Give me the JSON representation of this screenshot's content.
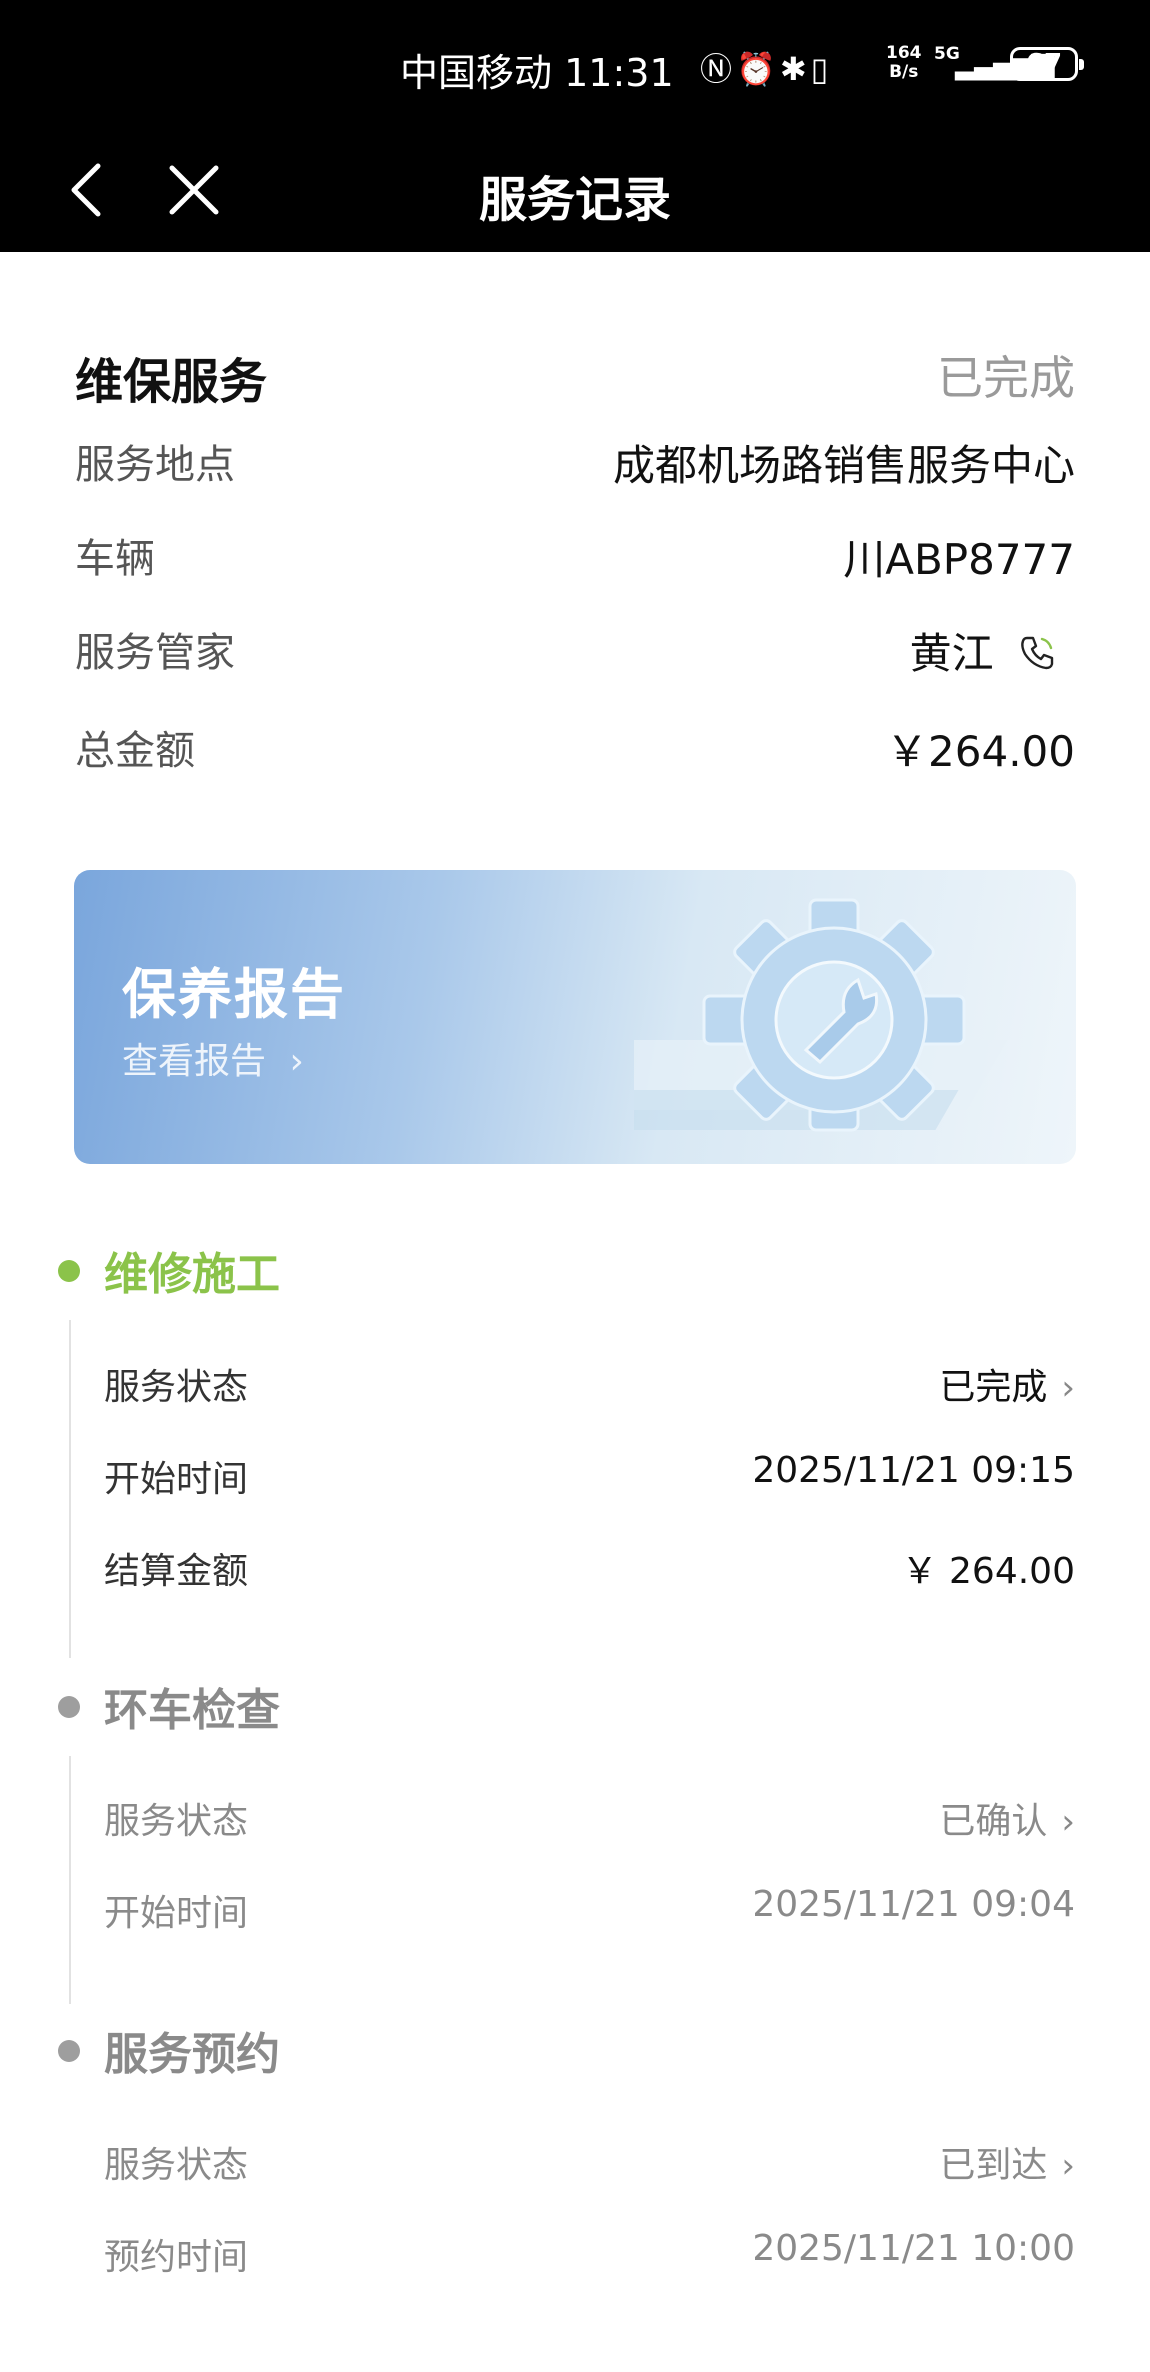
{
  "status_bar": {
    "carrier": "中国移动",
    "time": "11:31",
    "speed_top": "164",
    "speed_bottom": "B/s",
    "network": "5G",
    "battery": "67"
  },
  "nav": {
    "title": "服务记录"
  },
  "summary": {
    "title": "维保服务",
    "status": "已完成",
    "rows": [
      {
        "label": "服务地点",
        "value": "成都机场路销售服务中心"
      },
      {
        "label": "车辆",
        "value": "川ABP8777"
      },
      {
        "label": "服务管家",
        "value": "黄江"
      },
      {
        "label": "总金额",
        "value": "￥264.00"
      }
    ]
  },
  "banner": {
    "title": "保养报告",
    "link": "查看报告"
  },
  "sections": [
    {
      "title": "维修施工",
      "rows": [
        {
          "label": "服务状态",
          "value": "已完成"
        },
        {
          "label": "开始时间",
          "value": "2025/11/21 09:15"
        },
        {
          "label": "结算金额",
          "value": "￥ 264.00"
        }
      ]
    },
    {
      "title": "环车检查",
      "rows": [
        {
          "label": "服务状态",
          "value": "已确认"
        },
        {
          "label": "开始时间",
          "value": "2025/11/21 09:04"
        }
      ]
    },
    {
      "title": "服务预约",
      "rows": [
        {
          "label": "服务状态",
          "value": "已到达"
        },
        {
          "label": "预约时间",
          "value": "2025/11/21 10:00"
        }
      ]
    }
  ],
  "colors": {
    "accent_green": "#8bc34a",
    "inactive_grey": "#9e9e9e",
    "header_bg": "#000000"
  },
  "icons": {
    "back": "chevron-left-icon",
    "close": "close-icon",
    "phone": "phone-icon",
    "chevron": "chevron-right-icon",
    "gear": "gear-wrench-icon"
  }
}
